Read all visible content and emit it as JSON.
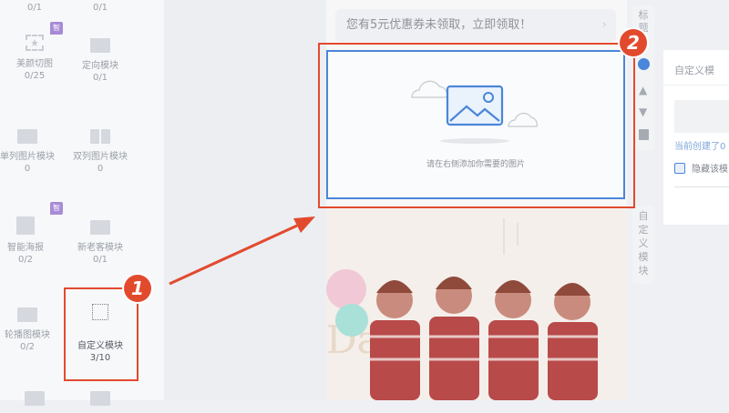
{
  "left_panel": {
    "modules": [
      {
        "label": "",
        "count": "0/1"
      },
      {
        "label": "",
        "count": "0/1"
      },
      {
        "label": "美颜切图",
        "count": "0/25",
        "badge": "智"
      },
      {
        "label": "定向模块",
        "count": "0/1"
      },
      {
        "label": "单列图片模块",
        "count": "0"
      },
      {
        "label": "双列图片模块",
        "count": "0"
      },
      {
        "label": "智能海报",
        "count": "0/2",
        "badge": "智"
      },
      {
        "label": "新老客模块",
        "count": "0/1"
      },
      {
        "label": "轮播图模块",
        "count": "0/2"
      },
      {
        "label": "自定义模块",
        "count": "3/10"
      }
    ]
  },
  "canvas": {
    "coupon_text": "您有5元优惠券未领取，立即领取！",
    "image_placeholder_hint": "请在右侧添加你需要的图片"
  },
  "toolbar": {
    "top_label": "标题",
    "side_label": "自定义模块"
  },
  "right_panel": {
    "title": "自定义模",
    "created_text": "当前创建了0",
    "hide_label": "隐藏该模"
  },
  "annotations": {
    "step1": "1",
    "step2": "2"
  },
  "colors": {
    "highlight_red": "#e24a2e",
    "selection_blue": "#4a86d9",
    "badge_purple": "#a78bd6"
  }
}
